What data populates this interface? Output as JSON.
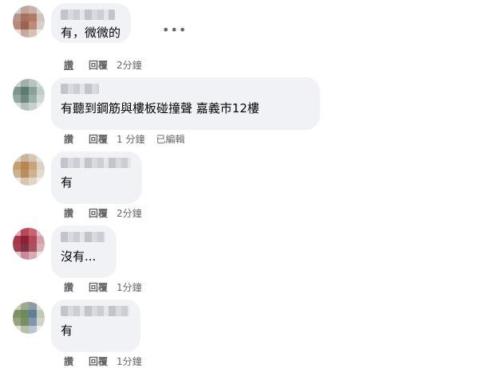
{
  "comments": [
    {
      "text": "有，微微的",
      "actions": {
        "like": "讚",
        "reply": "回覆",
        "time": "2分鐘"
      },
      "avatar_colors": [
        "#cfcfcf",
        "#bfa59c",
        "#c8b2aa",
        "#d9d9d9",
        "#b99388",
        "#a8705f",
        "#b07a66",
        "#d0c2bd",
        "#b58979",
        "#9a6452",
        "#c18a76",
        "#d8cfcb",
        "#e3dedb",
        "#c9a79b",
        "#d7c1b9",
        "#eeeeee"
      ]
    },
    {
      "text": "有聽到鋼筋與樓板碰撞聲 嘉義市12樓",
      "actions": {
        "like": "讚",
        "reply": "回覆",
        "time": "1 分鐘",
        "edited": "已編輯"
      },
      "avatar_colors": [
        "#c7d0cd",
        "#9fb0a9",
        "#b8c4c0",
        "#d6dbd9",
        "#7f9690",
        "#5f7a72",
        "#8aa09a",
        "#c3ccc9",
        "#94a8a2",
        "#6f8882",
        "#9cb0aa",
        "#cfd6d4",
        "#d9dedc",
        "#b4c1bd",
        "#c8d1ce",
        "#e6e9e8"
      ]
    },
    {
      "text": "有",
      "actions": {
        "like": "讚",
        "reply": "回覆",
        "time": "2分鐘"
      },
      "avatar_colors": [
        "#dad3c8",
        "#c9b59b",
        "#d5c7b3",
        "#e6e1d9",
        "#c49f73",
        "#b8864f",
        "#c7a27a",
        "#ddd1c2",
        "#cdb08c",
        "#b98e5f",
        "#cfb18e",
        "#e3dbcf",
        "#ebe6df",
        "#d6c6b0",
        "#e0d5c6",
        "#f2efea"
      ]
    },
    {
      "text": "沒有...",
      "actions": {
        "like": "讚",
        "reply": "回覆",
        "time": "1分鐘"
      },
      "avatar_colors": [
        "#d9a6ad",
        "#b84a57",
        "#c96572",
        "#e2c3c8",
        "#a83646",
        "#8c2233",
        "#b5485a",
        "#d7a0a9",
        "#9f4152",
        "#7d3442",
        "#a5535f",
        "#d6b3b8",
        "#e0c6ca",
        "#c58a93",
        "#d8aab1",
        "#efe3e5"
      ]
    },
    {
      "text": "有",
      "actions": {
        "like": "讚",
        "reply": "回覆",
        "time": "1分鐘"
      },
      "avatar_colors": [
        "#c6ccb9",
        "#9eab8d",
        "#8a9ba6",
        "#d7dbd0",
        "#7f9266",
        "#6d8a5c",
        "#5f7f9a",
        "#c2c9b6",
        "#93a57c",
        "#7a8e62",
        "#7f97ac",
        "#cfd4c6",
        "#dfe2d9",
        "#b7c0a8",
        "#b9c6d0",
        "#eef0eb"
      ]
    }
  ],
  "more_icon": "more-horizontal-icon",
  "more_symbol": "•••"
}
